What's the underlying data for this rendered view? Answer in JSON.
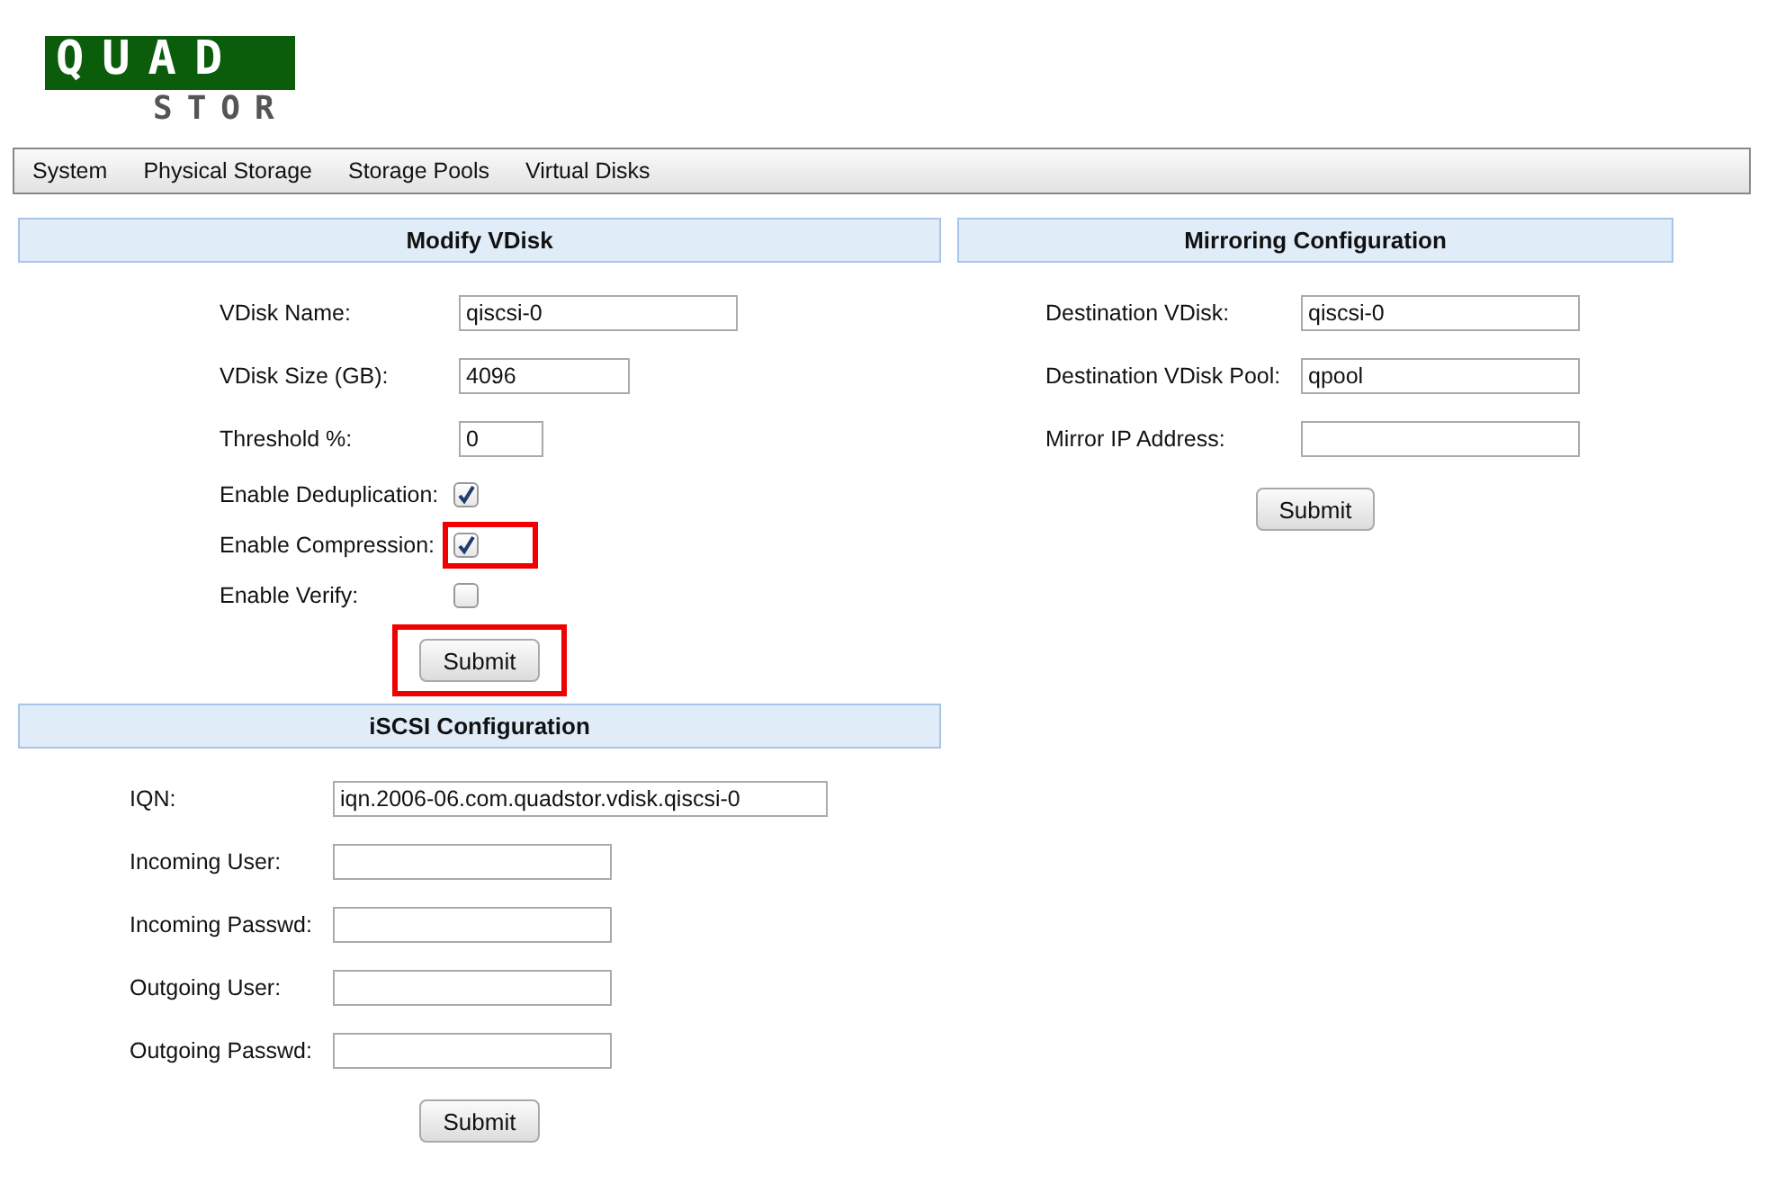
{
  "logo": {
    "top": "QUAD",
    "bottom": "STOR"
  },
  "nav": [
    {
      "label": "System"
    },
    {
      "label": "Physical Storage"
    },
    {
      "label": "Storage Pools"
    },
    {
      "label": "Virtual Disks"
    }
  ],
  "sections": [
    {
      "title": "Modify VDisk",
      "fields": [
        {
          "kind": "text",
          "label": "VDisk Name:",
          "value": "qiscsi-0"
        },
        {
          "kind": "text",
          "label": "VDisk Size (GB):",
          "value": "4096"
        },
        {
          "kind": "text",
          "label": "Threshold %:",
          "value": "0"
        },
        {
          "kind": "checkbox",
          "label": "Enable Deduplication:",
          "checked": true,
          "highlighted": false
        },
        {
          "kind": "checkbox",
          "label": "Enable Compression:",
          "checked": true,
          "highlighted": true
        },
        {
          "kind": "checkbox",
          "label": "Enable Verify:",
          "checked": false,
          "highlighted": false
        }
      ],
      "submit": {
        "label": "Submit",
        "highlighted": true
      }
    },
    {
      "title": "Mirroring Configuration",
      "fields": [
        {
          "kind": "text",
          "label": "Destination VDisk:",
          "value": "qiscsi-0"
        },
        {
          "kind": "text",
          "label": "Destination VDisk Pool:",
          "value": "qpool"
        },
        {
          "kind": "text",
          "label": "Mirror IP Address:"
        }
      ],
      "submit": {
        "label": "Submit",
        "highlighted": false
      }
    },
    {
      "title": "iSCSI Configuration",
      "fields": [
        {
          "kind": "text",
          "label": "IQN:",
          "value": "iqn.2006-06.com.quadstor.vdisk.qiscsi-0"
        },
        {
          "kind": "text",
          "label": "Incoming User:"
        },
        {
          "kind": "text",
          "label": "Incoming Passwd:"
        },
        {
          "kind": "text",
          "label": "Outgoing User:"
        },
        {
          "kind": "text",
          "label": "Outgoing Passwd:"
        }
      ],
      "submit": {
        "label": "Submit",
        "highlighted": false
      }
    }
  ]
}
